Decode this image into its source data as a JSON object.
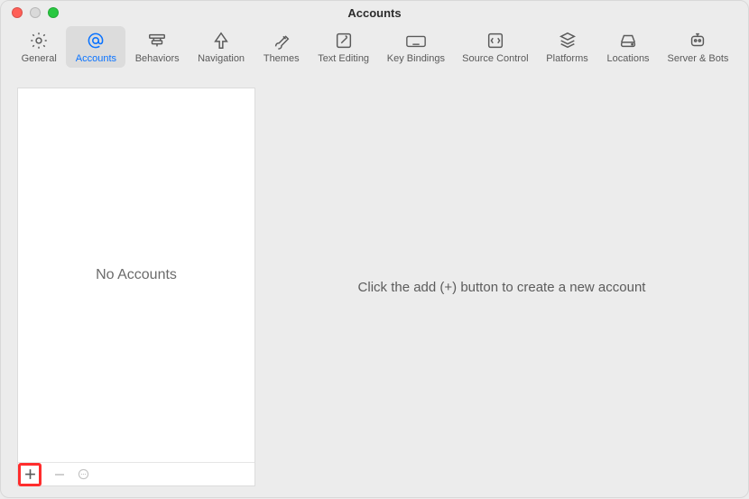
{
  "window": {
    "title": "Accounts"
  },
  "toolbar": {
    "items": [
      {
        "id": "general",
        "label": "General"
      },
      {
        "id": "accounts",
        "label": "Accounts"
      },
      {
        "id": "behaviors",
        "label": "Behaviors"
      },
      {
        "id": "navigation",
        "label": "Navigation"
      },
      {
        "id": "themes",
        "label": "Themes"
      },
      {
        "id": "text-editing",
        "label": "Text Editing"
      },
      {
        "id": "key-bindings",
        "label": "Key Bindings"
      },
      {
        "id": "source-control",
        "label": "Source Control"
      },
      {
        "id": "platforms",
        "label": "Platforms"
      },
      {
        "id": "locations",
        "label": "Locations"
      },
      {
        "id": "server-bots",
        "label": "Server & Bots"
      }
    ],
    "selected": "accounts"
  },
  "sidebar": {
    "empty_message": "No Accounts"
  },
  "detail": {
    "prompt": "Click the add (+) button to create a new account"
  }
}
